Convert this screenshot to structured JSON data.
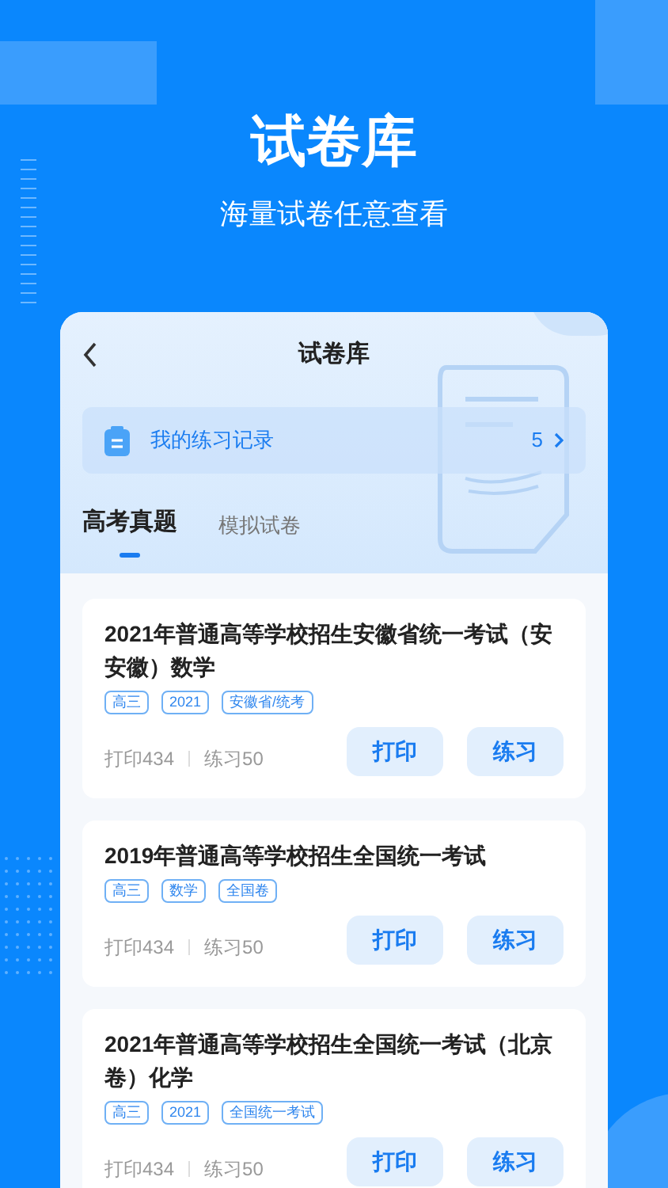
{
  "hero": {
    "title": "试卷库",
    "subtitle": "海量试卷任意查看"
  },
  "app": {
    "title": "试卷库",
    "record": {
      "label": "我的练习记录",
      "count": "5"
    },
    "tabs": [
      {
        "label": "高考真题",
        "selected": true
      },
      {
        "label": "模拟试卷",
        "selected": false
      }
    ],
    "papers": [
      {
        "title": "2021年普通高等学校招生安徽省统一考试（安安徽）数学",
        "tags": [
          "高三",
          "2021",
          "安徽省/统考"
        ],
        "prints": "打印434",
        "practices": "练习50",
        "buttons": [
          "打印",
          "练习"
        ]
      },
      {
        "title": "2019年普通高等学校招生全国统一考试",
        "tags": [
          "高三",
          "数学",
          "全国卷"
        ],
        "prints": "打印434",
        "practices": "练习50",
        "buttons": [
          "打印",
          "练习"
        ]
      },
      {
        "title": "2021年普通高等学校招生全国统一考试（北京卷）化学",
        "tags": [
          "高三",
          "2021",
          "全国统一考试"
        ],
        "prints": "打印434",
        "practices": "练习50",
        "buttons": [
          "打印",
          "练习"
        ]
      }
    ]
  }
}
